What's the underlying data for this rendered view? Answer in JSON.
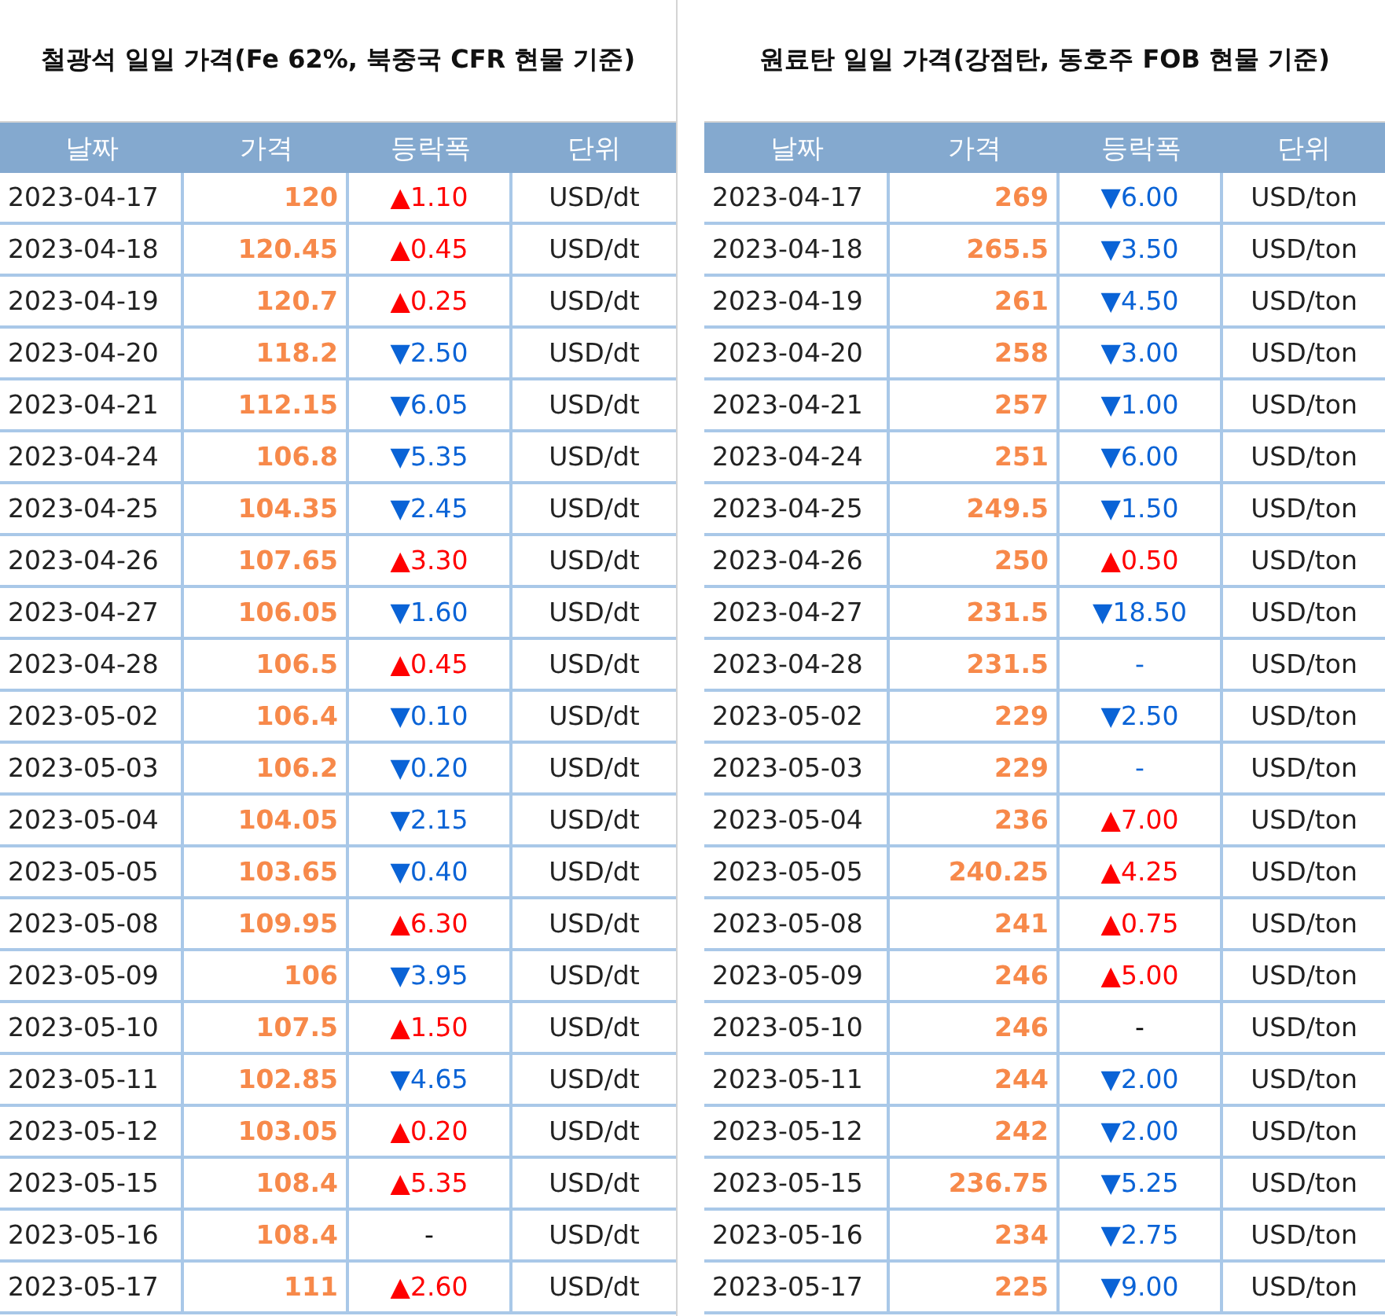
{
  "tables": [
    {
      "title": "철광석 일일 가격(Fe 62%, 북중국 CFR 현물 기준)",
      "columns": [
        "날짜",
        "가격",
        "등락폭",
        "단위"
      ],
      "rows": [
        {
          "date": "2023-04-17",
          "price": "120",
          "change": "▲1.10",
          "kind": "up",
          "unit": "USD/dt"
        },
        {
          "date": "2023-04-18",
          "price": "120.45",
          "change": "▲0.45",
          "kind": "up",
          "unit": "USD/dt"
        },
        {
          "date": "2023-04-19",
          "price": "120.7",
          "change": "▲0.25",
          "kind": "up",
          "unit": "USD/dt"
        },
        {
          "date": "2023-04-20",
          "price": "118.2",
          "change": "▼2.50",
          "kind": "down",
          "unit": "USD/dt"
        },
        {
          "date": "2023-04-21",
          "price": "112.15",
          "change": "▼6.05",
          "kind": "down",
          "unit": "USD/dt"
        },
        {
          "date": "2023-04-24",
          "price": "106.8",
          "change": "▼5.35",
          "kind": "down",
          "unit": "USD/dt"
        },
        {
          "date": "2023-04-25",
          "price": "104.35",
          "change": "▼2.45",
          "kind": "down",
          "unit": "USD/dt"
        },
        {
          "date": "2023-04-26",
          "price": "107.65",
          "change": "▲3.30",
          "kind": "up",
          "unit": "USD/dt"
        },
        {
          "date": "2023-04-27",
          "price": "106.05",
          "change": "▼1.60",
          "kind": "down",
          "unit": "USD/dt"
        },
        {
          "date": "2023-04-28",
          "price": "106.5",
          "change": "▲0.45",
          "kind": "up",
          "unit": "USD/dt"
        },
        {
          "date": "2023-05-02",
          "price": "106.4",
          "change": "▼0.10",
          "kind": "down",
          "unit": "USD/dt"
        },
        {
          "date": "2023-05-03",
          "price": "106.2",
          "change": "▼0.20",
          "kind": "down",
          "unit": "USD/dt"
        },
        {
          "date": "2023-05-04",
          "price": "104.05",
          "change": "▼2.15",
          "kind": "down",
          "unit": "USD/dt"
        },
        {
          "date": "2023-05-05",
          "price": "103.65",
          "change": "▼0.40",
          "kind": "down",
          "unit": "USD/dt"
        },
        {
          "date": "2023-05-08",
          "price": "109.95",
          "change": "▲6.30",
          "kind": "up",
          "unit": "USD/dt"
        },
        {
          "date": "2023-05-09",
          "price": "106",
          "change": "▼3.95",
          "kind": "down",
          "unit": "USD/dt"
        },
        {
          "date": "2023-05-10",
          "price": "107.5",
          "change": "▲1.50",
          "kind": "up",
          "unit": "USD/dt"
        },
        {
          "date": "2023-05-11",
          "price": "102.85",
          "change": "▼4.65",
          "kind": "down",
          "unit": "USD/dt"
        },
        {
          "date": "2023-05-12",
          "price": "103.05",
          "change": "▲0.20",
          "kind": "up",
          "unit": "USD/dt"
        },
        {
          "date": "2023-05-15",
          "price": "108.4",
          "change": "▲5.35",
          "kind": "up",
          "unit": "USD/dt"
        },
        {
          "date": "2023-05-16",
          "price": "108.4",
          "change": "-",
          "kind": "flat",
          "unit": "USD/dt"
        },
        {
          "date": "2023-05-17",
          "price": "111",
          "change": "▲2.60",
          "kind": "up",
          "unit": "USD/dt"
        }
      ]
    },
    {
      "title": "원료탄 일일 가격(강점탄, 동호주 FOB 현물 기준)",
      "columns": [
        "날짜",
        "가격",
        "등락폭",
        "단위"
      ],
      "rows": [
        {
          "date": "2023-04-17",
          "price": "269",
          "change": "▼6.00",
          "kind": "down",
          "unit": "USD/ton"
        },
        {
          "date": "2023-04-18",
          "price": "265.5",
          "change": "▼3.50",
          "kind": "down",
          "unit": "USD/ton"
        },
        {
          "date": "2023-04-19",
          "price": "261",
          "change": "▼4.50",
          "kind": "down",
          "unit": "USD/ton"
        },
        {
          "date": "2023-04-20",
          "price": "258",
          "change": "▼3.00",
          "kind": "down",
          "unit": "USD/ton"
        },
        {
          "date": "2023-04-21",
          "price": "257",
          "change": "▼1.00",
          "kind": "down",
          "unit": "USD/ton"
        },
        {
          "date": "2023-04-24",
          "price": "251",
          "change": "▼6.00",
          "kind": "down",
          "unit": "USD/ton"
        },
        {
          "date": "2023-04-25",
          "price": "249.5",
          "change": "▼1.50",
          "kind": "down",
          "unit": "USD/ton"
        },
        {
          "date": "2023-04-26",
          "price": "250",
          "change": "▲0.50",
          "kind": "up",
          "unit": "USD/ton"
        },
        {
          "date": "2023-04-27",
          "price": "231.5",
          "change": "▼18.50",
          "kind": "down",
          "unit": "USD/ton"
        },
        {
          "date": "2023-04-28",
          "price": "231.5",
          "change": "-",
          "kind": "down",
          "unit": "USD/ton"
        },
        {
          "date": "2023-05-02",
          "price": "229",
          "change": "▼2.50",
          "kind": "down",
          "unit": "USD/ton"
        },
        {
          "date": "2023-05-03",
          "price": "229",
          "change": "-",
          "kind": "down",
          "unit": "USD/ton"
        },
        {
          "date": "2023-05-04",
          "price": "236",
          "change": "▲7.00",
          "kind": "up",
          "unit": "USD/ton"
        },
        {
          "date": "2023-05-05",
          "price": "240.25",
          "change": "▲4.25",
          "kind": "up",
          "unit": "USD/ton"
        },
        {
          "date": "2023-05-08",
          "price": "241",
          "change": "▲0.75",
          "kind": "up",
          "unit": "USD/ton"
        },
        {
          "date": "2023-05-09",
          "price": "246",
          "change": "▲5.00",
          "kind": "up",
          "unit": "USD/ton"
        },
        {
          "date": "2023-05-10",
          "price": "246",
          "change": "-",
          "kind": "flat",
          "unit": "USD/ton"
        },
        {
          "date": "2023-05-11",
          "price": "244",
          "change": "▼2.00",
          "kind": "down",
          "unit": "USD/ton"
        },
        {
          "date": "2023-05-12",
          "price": "242",
          "change": "▼2.00",
          "kind": "down",
          "unit": "USD/ton"
        },
        {
          "date": "2023-05-15",
          "price": "236.75",
          "change": "▼5.25",
          "kind": "down",
          "unit": "USD/ton"
        },
        {
          "date": "2023-05-16",
          "price": "234",
          "change": "▼2.75",
          "kind": "down",
          "unit": "USD/ton"
        },
        {
          "date": "2023-05-17",
          "price": "225",
          "change": "▼9.00",
          "kind": "down",
          "unit": "USD/ton"
        }
      ]
    }
  ]
}
